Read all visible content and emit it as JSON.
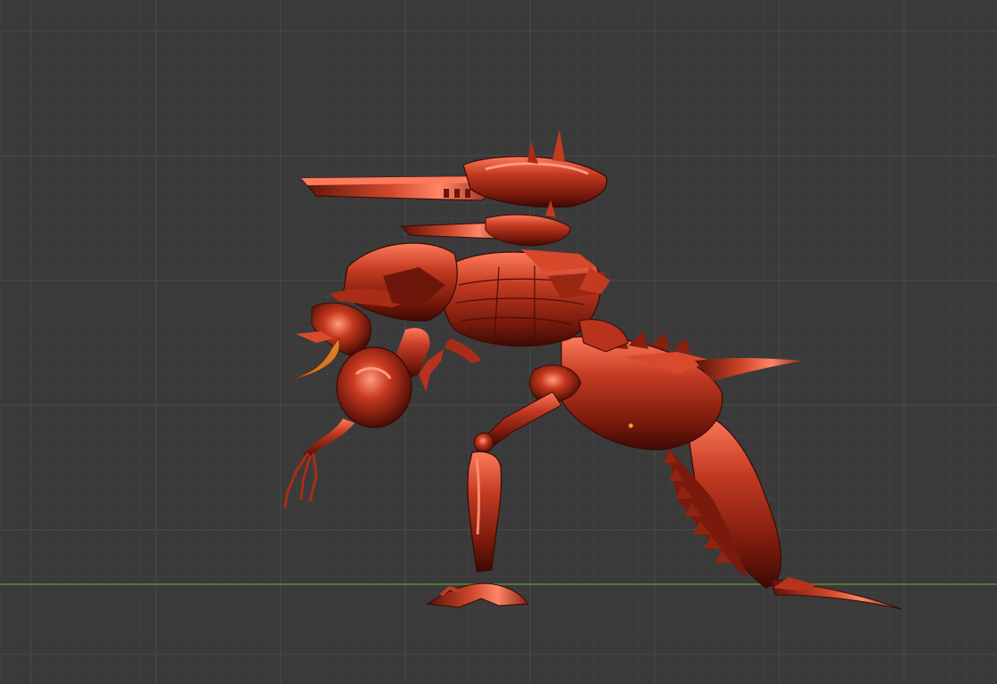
{
  "viewport": {
    "background_color": "#3a3a3a",
    "grid_minor_color": "#444444",
    "grid_major_color": "#4b4b4b",
    "x_axis_color": "#4f7a2c",
    "model": {
      "name_icon": "mech-mantis-model",
      "shading": "metallic",
      "base_color": "#b8321e",
      "shadow_color": "#4a0e06",
      "highlight_color": "#ff8a6a",
      "tusk_color": "#e67a1e",
      "origin_marker_color": "#ff9a1a"
    }
  }
}
